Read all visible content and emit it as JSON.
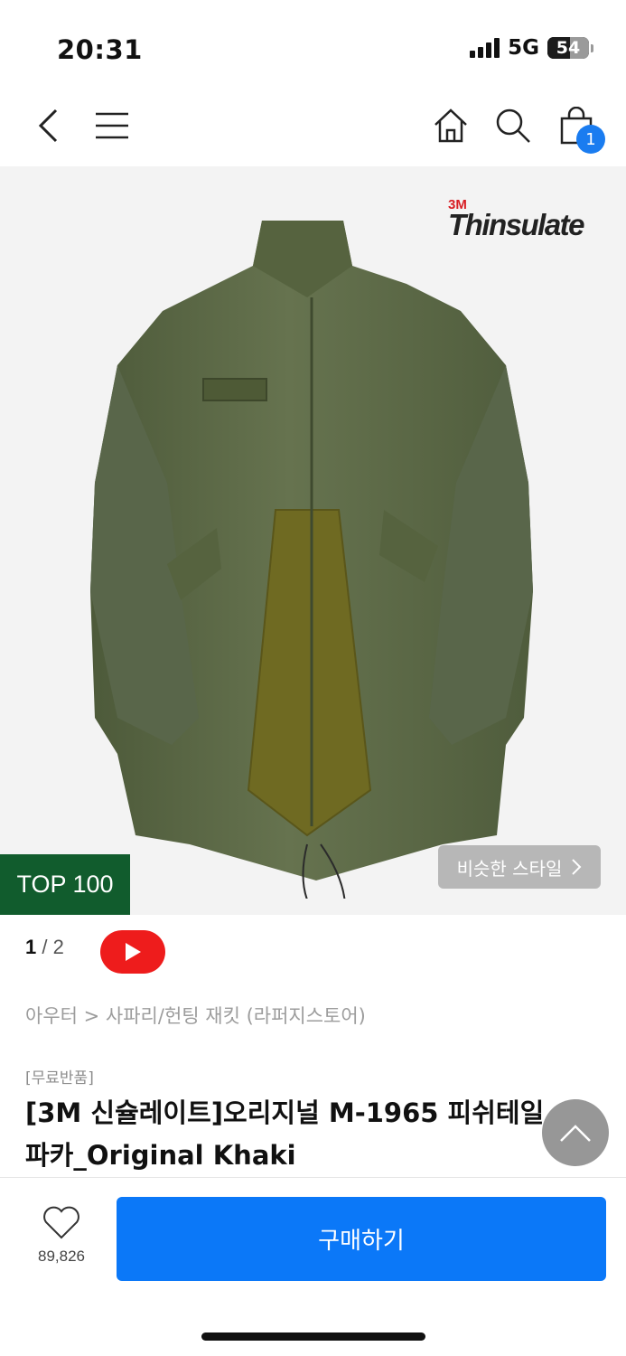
{
  "status_bar": {
    "time": "20:31",
    "network": "5G",
    "battery": "54",
    "battery_level": 0.54
  },
  "nav": {
    "cart_count": "1"
  },
  "hero": {
    "brand_prefix": "3M",
    "brand_name": "Thinsulate",
    "rank_badge": "TOP 100",
    "similar_style_label": "비슷한 스타일",
    "background_color": "#f3f3f3",
    "jacket_color": "#5d6a48"
  },
  "pager": {
    "current": "1",
    "separator": " / ",
    "total": "2"
  },
  "product": {
    "breadcrumb": "아우터 > 사파리/헌팅 재킷 (라퍼지스토어)",
    "free_return": "[무료반품]",
    "title": "[3M 신슐레이트]오리지널 M-1965 피쉬테일 파카_Original Khaki"
  },
  "bottom_bar": {
    "like_count": "89,826",
    "buy_label": "구매하기"
  },
  "colors": {
    "accent": "#0b78f8",
    "top_badge": "#115c2d",
    "youtube": "#ee1c1c",
    "cart_badge": "#1a7cf0"
  }
}
